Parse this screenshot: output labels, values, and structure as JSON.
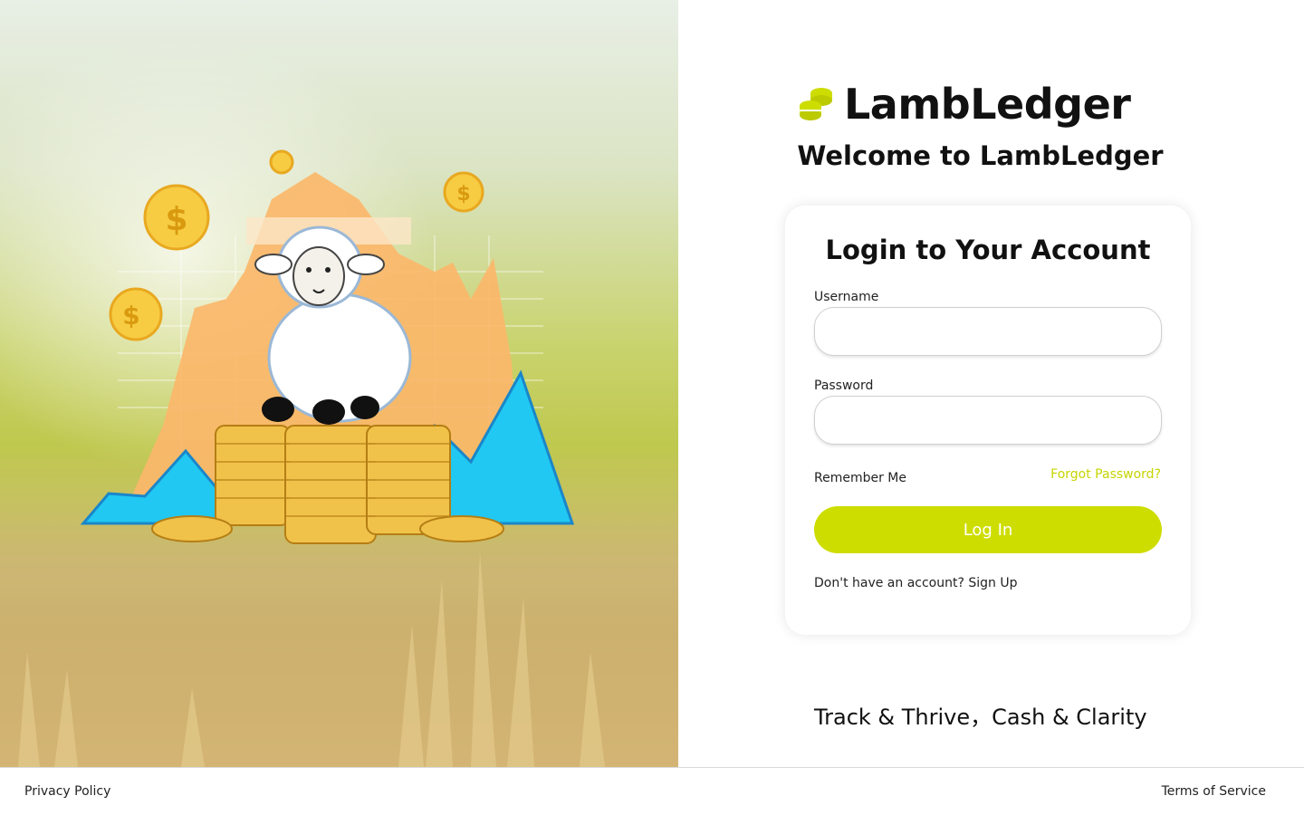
{
  "brand": {
    "name": "LambLedger",
    "logo_icon": "coin-stack-icon",
    "accent": "#cedd00"
  },
  "welcome": "Welcome to LambLedger",
  "login": {
    "title": "Login to Your Account",
    "username_label": "Username",
    "username_value": "",
    "password_label": "Password",
    "password_value": "",
    "remember_label": "Remember Me",
    "forgot_label": "Forgot Password?",
    "submit_label": "Log In",
    "signup_prompt": "Don't have an account? ",
    "signup_link": "Sign Up"
  },
  "tagline": "Track & Thrive，Cash & Clarity",
  "footer": {
    "privacy": "Privacy Policy",
    "terms": "Terms of Service"
  },
  "hero": {
    "image_icon": "sheep-on-coins-illustration"
  }
}
